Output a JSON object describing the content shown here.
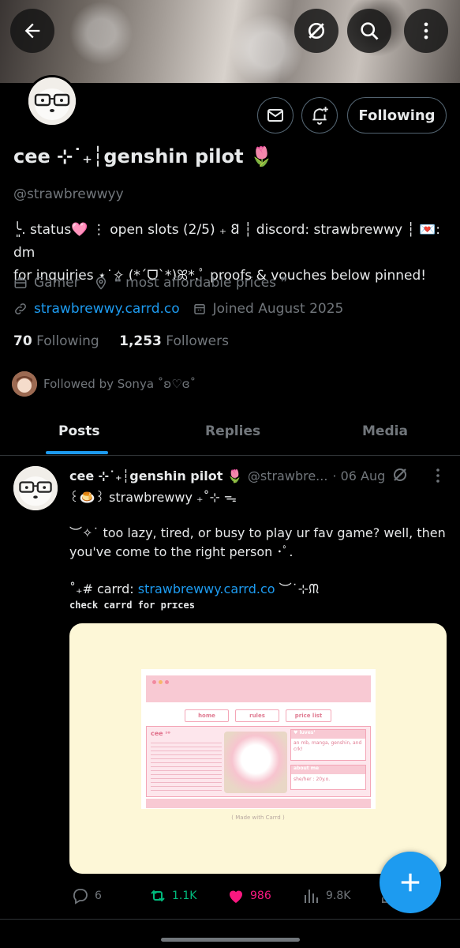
{
  "profile": {
    "name": "cee ⊹˙₊┆genshin pilot 🌷",
    "handle": "@strawbrewwyy",
    "bio_line1": "╰͈. status🩷 ⋮ open slots (2/5) ₊ 𐐒 ┆ discord: strawbrewwy ┆ 💌: dm",
    "bio_line2": "for inquiries ⋆˙✧ (*ˊᗜˋ*)ꕤ*.ﾟ proofs & vouches below pinned!",
    "category": "Gamer",
    "location": "❝ most affordable prices ❞",
    "website": "strawbrewwy.carrd.co",
    "joined": "Joined August 2025",
    "following_count": "70",
    "following_label": "Following",
    "followers_count": "1,253",
    "followers_label": "Followers",
    "followed_by": "Followed by Sonya ˚ʚ♡ɞ˚"
  },
  "header": {
    "follow_button": "Following"
  },
  "tabs": [
    {
      "label": "Posts"
    },
    {
      "label": "Replies"
    },
    {
      "label": "Media"
    }
  ],
  "post": {
    "author_name": "cee ⊹˙₊┆genshin pilot 🌷",
    "author_handle": "@strawbre...",
    "date": "· 06 Aug",
    "line1": "꒰🍮꒱ strawbrewwy ₊˚⊹ ᯓ",
    "line2": "︶✧˙ too lazy, tired, or busy to play ur fav game? well, then",
    "line3": "you've come to the right person ･ﾟ.",
    "line4_prefix": "˚₊# carrd: ",
    "line4_link": "strawbrewwy.carrd.co",
    "line4_suffix": " ︶˙⊹ᙏ",
    "line5": "check carrd for prɪces",
    "preview": {
      "nav": [
        "home",
        "rules",
        "price list"
      ],
      "title": "cee ᶦᵒ",
      "box1_title": "♥ luvesʼ",
      "box1_text": "an mb, manga, genshin, and crk!",
      "box2_title": "about me",
      "box2_text": "she/her : 20y.o.",
      "footer": "( Made with Carrd )"
    },
    "stats": {
      "replies": "6",
      "reposts": "1.1K",
      "likes": "986",
      "views": "9.8K"
    }
  },
  "colors": {
    "accent": "#1d9bf0",
    "repost": "#00ba7c",
    "like": "#f91880",
    "muted": "#71767b"
  }
}
